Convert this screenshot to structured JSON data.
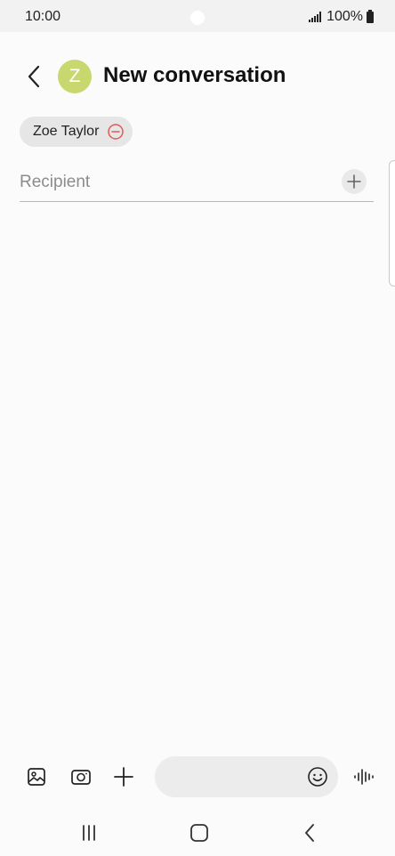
{
  "status_bar": {
    "time": "10:00",
    "battery_text": "100%",
    "icons": [
      "signal-icon",
      "battery-icon"
    ]
  },
  "header": {
    "title": "New conversation",
    "avatar_initial": "Z",
    "avatar_color": "#c8d86f",
    "back_icon": "chevron-left-icon"
  },
  "recipients": {
    "chips": [
      {
        "label": "Zoe Taylor",
        "remove_icon": "minus-circle-icon",
        "remove_color": "#e05a5a"
      }
    ],
    "input": {
      "placeholder": "Recipient",
      "value": ""
    },
    "add_icon": "plus-icon"
  },
  "composer": {
    "icons": [
      "gallery-icon",
      "camera-icon",
      "plus-icon",
      "emoji-icon",
      "voice-wave-icon"
    ],
    "message_value": ""
  },
  "navigation": {
    "icons": [
      "recent-apps-icon",
      "home-icon",
      "back-icon"
    ]
  }
}
